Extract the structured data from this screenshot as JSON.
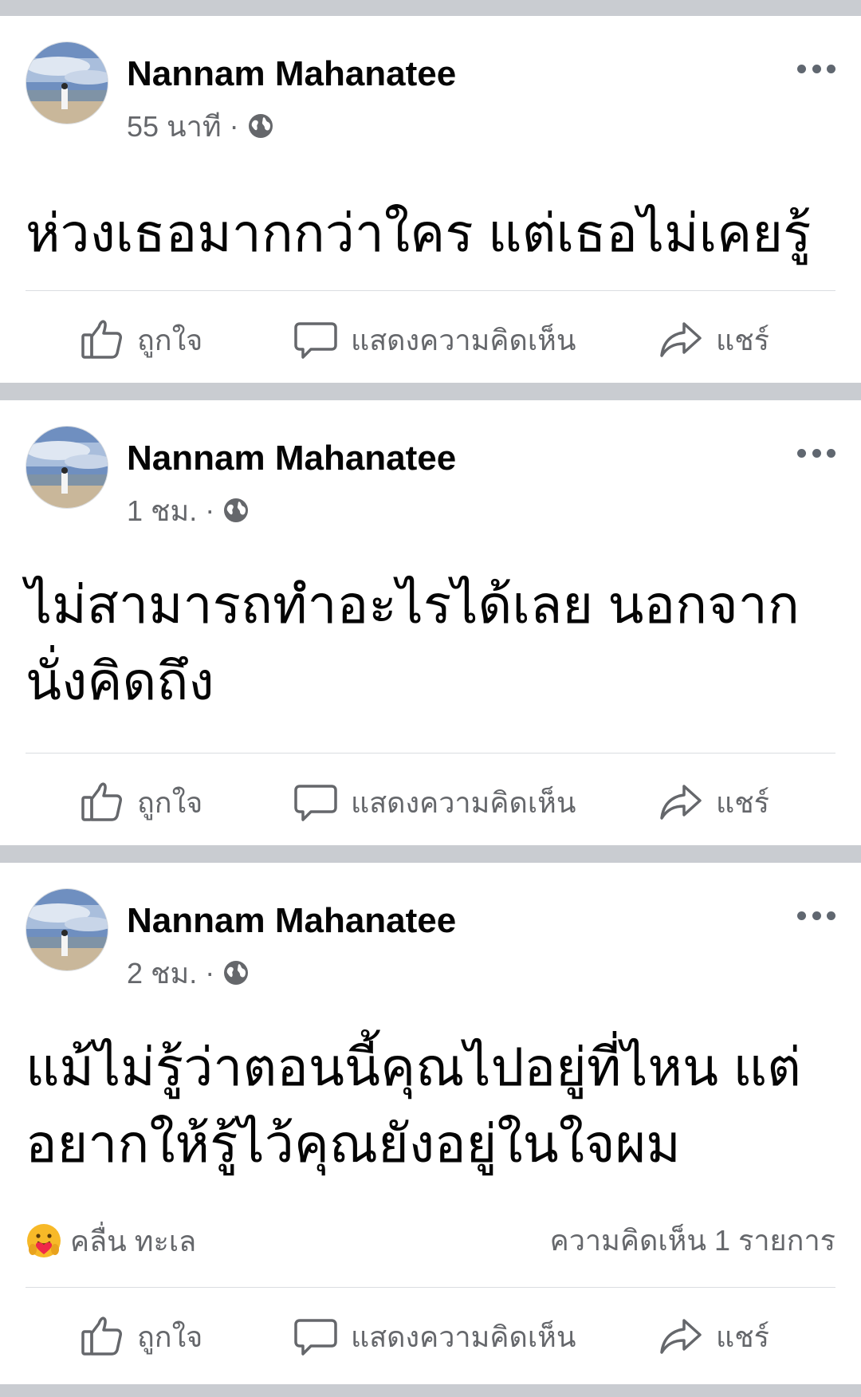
{
  "posts": [
    {
      "author": "Nannam Mahanatee",
      "time": "55 นาที",
      "separator": "·",
      "privacy_icon": "globe-icon",
      "text_lines": [
        "ห่วงเธอมากกว่าใคร แต่เธอไม่เคยรู้"
      ],
      "actions": {
        "like": "ถูกใจ",
        "comment": "แสดงความคิดเห็น",
        "share": "แชร์"
      }
    },
    {
      "author": "Nannam Mahanatee",
      "time": "1 ชม.",
      "separator": "·",
      "privacy_icon": "globe-icon",
      "text_lines": [
        "ไม่สามารถทำอะไรได้เลย นอกจาก",
        "นั่งคิดถึง"
      ],
      "actions": {
        "like": "ถูกใจ",
        "comment": "แสดงความคิดเห็น",
        "share": "แชร์"
      }
    },
    {
      "author": "Nannam Mahanatee",
      "time": "2 ชม.",
      "separator": "·",
      "privacy_icon": "globe-icon",
      "text_lines": [
        "แม้ไม่รู้ว่าตอนนี้คุณไปอยู่ที่ไหน แต่",
        "อยากให้รู้ไว้คุณยังอยู่ในใจผม"
      ],
      "reaction": {
        "icon": "care-reaction-icon",
        "name": "คลื่น ทะเล"
      },
      "comment_count": "ความคิดเห็น 1 รายการ",
      "actions": {
        "like": "ถูกใจ",
        "comment": "แสดงความคิดเห็น",
        "share": "แชร์"
      }
    }
  ],
  "colors": {
    "feed_background": "#c9ccd1",
    "card_background": "#ffffff",
    "secondary_text": "#65676b",
    "divider": "#dadde1",
    "care_reaction": "#f7b928"
  }
}
